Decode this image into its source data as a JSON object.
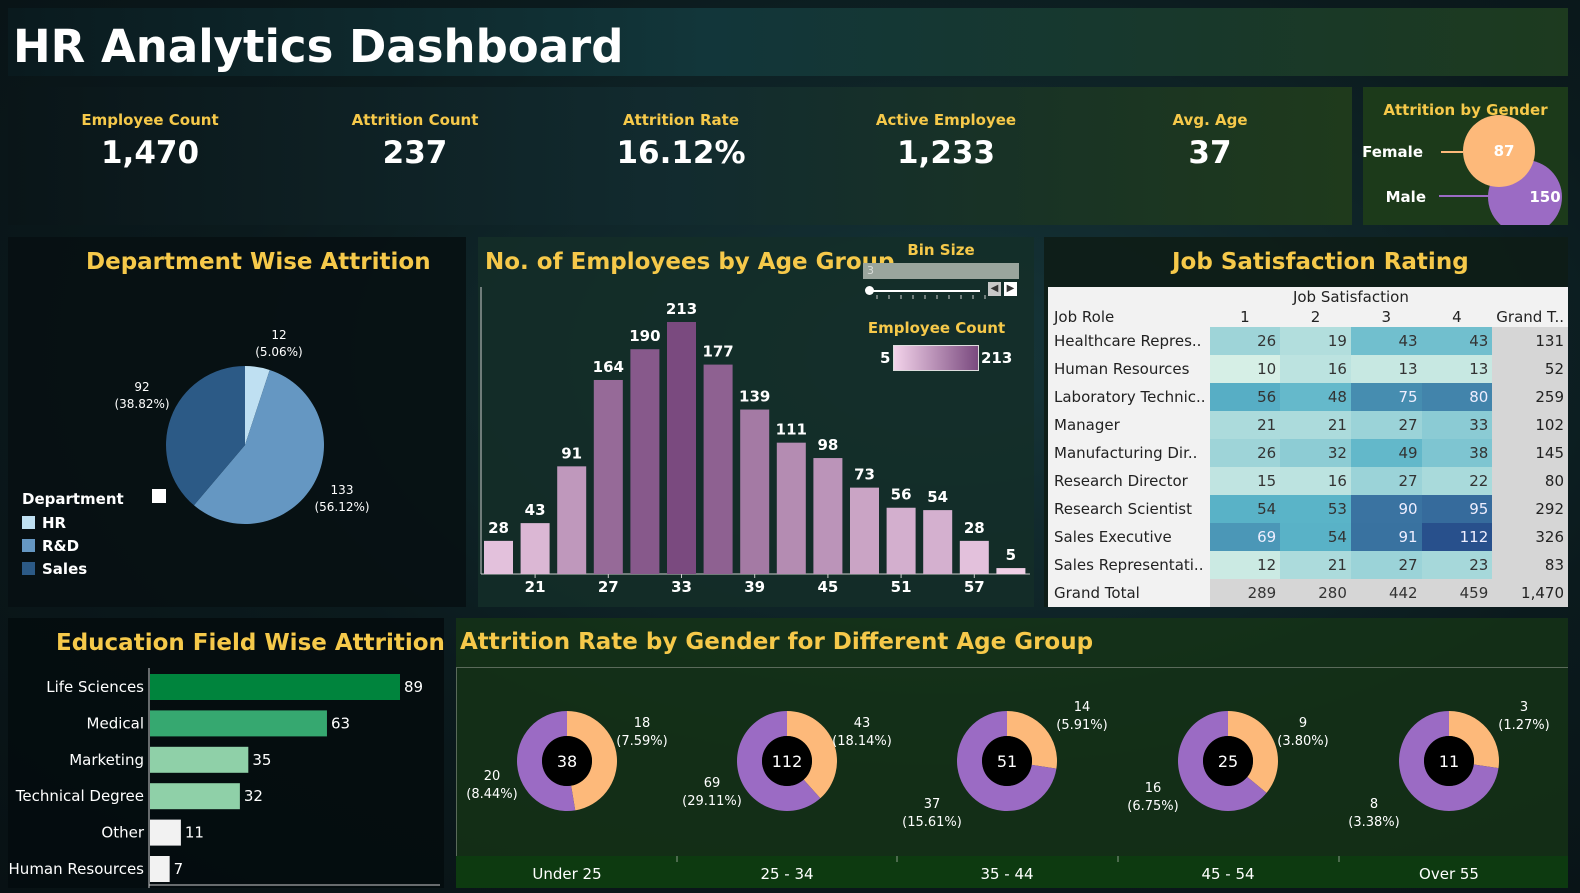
{
  "title": "HR Analytics Dashboard",
  "kpis": [
    {
      "label": "Employee Count",
      "value": "1,470"
    },
    {
      "label": "Attrition Count",
      "value": "237"
    },
    {
      "label": "Attrition Rate",
      "value": "16.12%"
    },
    {
      "label": "Active Employee",
      "value": "1,233"
    },
    {
      "label": "Avg. Age",
      "value": "37"
    }
  ],
  "gender": {
    "title": "Attrition by Gender",
    "items": [
      {
        "label": "Female",
        "value": 87,
        "color": "#fdb97a"
      },
      {
        "label": "Male",
        "value": 150,
        "color": "#9b6bc4"
      }
    ]
  },
  "department": {
    "title": "Department Wise Attrition",
    "legend_title": "Department",
    "legend": [
      {
        "label": "HR",
        "color": "#bfe0f2"
      },
      {
        "label": "R&D",
        "color": "#6597c2"
      },
      {
        "label": "Sales",
        "color": "#2c5a86"
      }
    ]
  },
  "age_group": {
    "title": "No. of Employees by Age Group",
    "bin_label": "Bin Size",
    "bin_value": "3",
    "legend_title": "Employee Count",
    "legend_min": "5",
    "legend_max": "213"
  },
  "job_satisfaction": {
    "title": "Job Satisfaction Rating",
    "col_group": "Job Satisfaction",
    "row_header": "Job Role",
    "columns": [
      "1",
      "2",
      "3",
      "4",
      "Grand T.."
    ],
    "rows": [
      {
        "role": "Healthcare Repres..",
        "values": [
          26,
          19,
          43,
          43
        ],
        "total": "131"
      },
      {
        "role": "Human Resources",
        "values": [
          10,
          16,
          13,
          13
        ],
        "total": "52"
      },
      {
        "role": "Laboratory Technic..",
        "values": [
          56,
          48,
          75,
          80
        ],
        "total": "259"
      },
      {
        "role": "Manager",
        "values": [
          21,
          21,
          27,
          33
        ],
        "total": "102"
      },
      {
        "role": "Manufacturing Dir..",
        "values": [
          26,
          32,
          49,
          38
        ],
        "total": "145"
      },
      {
        "role": "Research Director",
        "values": [
          15,
          16,
          27,
          22
        ],
        "total": "80"
      },
      {
        "role": "Research Scientist",
        "values": [
          54,
          53,
          90,
          95
        ],
        "total": "292"
      },
      {
        "role": "Sales Executive",
        "values": [
          69,
          54,
          91,
          112
        ],
        "total": "326"
      },
      {
        "role": "Sales Representati..",
        "values": [
          12,
          21,
          27,
          23
        ],
        "total": "83"
      }
    ],
    "grand_total": {
      "label": "Grand Total",
      "values": [
        "289",
        "280",
        "442",
        "459"
      ],
      "total": "1,470"
    }
  },
  "education": {
    "title": "Education Field Wise Attrition"
  },
  "age_gender": {
    "title": "Attrition Rate by Gender for Different Age Group"
  },
  "chart_data": [
    {
      "type": "pie",
      "title": "Department Wise Attrition",
      "categories": [
        "HR",
        "R&D",
        "Sales"
      ],
      "values": [
        12,
        133,
        92
      ],
      "labels": [
        "(5.06%)",
        "(56.12%)",
        "(38.82%)"
      ],
      "colors": [
        "#bfe0f2",
        "#6597c2",
        "#2c5a86"
      ]
    },
    {
      "type": "bar",
      "title": "No. of Employees by Age Group",
      "x": [
        18,
        21,
        24,
        27,
        30,
        33,
        36,
        39,
        42,
        45,
        48,
        51,
        54,
        57,
        60
      ],
      "values": [
        28,
        43,
        91,
        164,
        190,
        213,
        177,
        139,
        111,
        98,
        73,
        56,
        54,
        28,
        5
      ],
      "tick_labels": [
        "21",
        "27",
        "33",
        "39",
        "45",
        "51",
        "57"
      ],
      "color_range": [
        "#f3d3ea",
        "#7a4a7f"
      ]
    },
    {
      "type": "bar",
      "title": "Education Field Wise Attrition",
      "categories": [
        "Life Sciences",
        "Medical",
        "Marketing",
        "Technical Degree",
        "Other",
        "Human Resources"
      ],
      "values": [
        89,
        63,
        35,
        32,
        11,
        7
      ],
      "colors": [
        "#00843d",
        "#36a870",
        "#8fd0a8",
        "#8fd0a8",
        "#f2f2f2",
        "#f2f2f2"
      ]
    },
    {
      "type": "pie",
      "title": "Attrition Rate by Gender for Different Age Group",
      "categories": [
        "Under 25",
        "25 - 34",
        "35 - 44",
        "45 - 54",
        "Over 55"
      ],
      "totals": [
        38,
        112,
        51,
        25,
        11
      ],
      "female": [
        18,
        43,
        14,
        9,
        3
      ],
      "female_labels": [
        "(7.59%)",
        "(18.14%)",
        "(5.91%)",
        "(3.80%)",
        "(1.27%)"
      ],
      "male": [
        20,
        69,
        37,
        16,
        8
      ],
      "male_labels": [
        "(8.44%)",
        "(29.11%)",
        "(15.61%)",
        "(6.75%)",
        "(3.38%)"
      ],
      "colors": {
        "female": "#fdb97a",
        "male": "#9b6bc4"
      }
    }
  ]
}
